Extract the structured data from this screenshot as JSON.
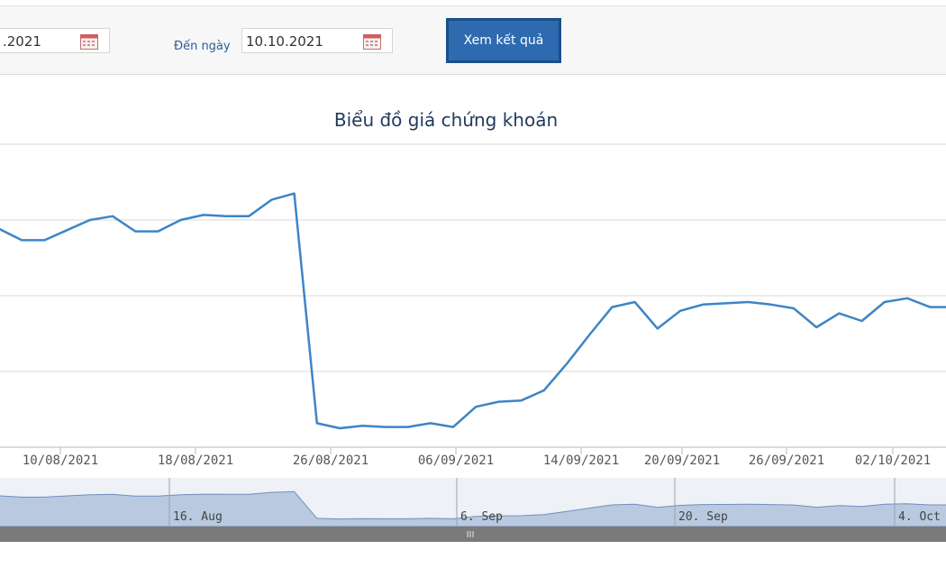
{
  "filters": {
    "from_date": ".2021",
    "to_label": "Đến ngày",
    "to_date": "10.10.2021",
    "submit_label": "Xem kết quả"
  },
  "chart_data": {
    "type": "line",
    "title": "Biểu đồ giá chứng khoán",
    "x_tick_labels": [
      "10/08/2021",
      "18/08/2021",
      "26/08/2021",
      "06/09/2021",
      "14/09/2021",
      "20/09/2021",
      "26/09/2021",
      "02/10/2021"
    ],
    "y_gridlines": 5,
    "series": [
      {
        "color": "#3d85c6",
        "values": [
          66.5,
          62.0,
          62.0,
          66.0,
          70.0,
          71.5,
          65.5,
          65.5,
          70.0,
          72.0,
          71.5,
          71.5,
          78.0,
          80.5,
          -10.5,
          -12.5,
          -11.5,
          -12.0,
          -12.0,
          -10.5,
          -12.0,
          -4.0,
          -2.0,
          -1.5,
          2.5,
          13.0,
          24.5,
          35.5,
          37.5,
          27.0,
          34.0,
          36.5,
          37.0,
          37.5,
          36.5,
          35.0,
          27.5,
          33.0,
          30.0,
          37.5,
          39.0,
          35.5,
          35.5,
          36.5
        ]
      }
    ],
    "navigator": {
      "tick_labels": [
        "16. Aug",
        "6. Sep",
        "20. Sep",
        "4. Oct"
      ],
      "handle_label": "III"
    }
  }
}
